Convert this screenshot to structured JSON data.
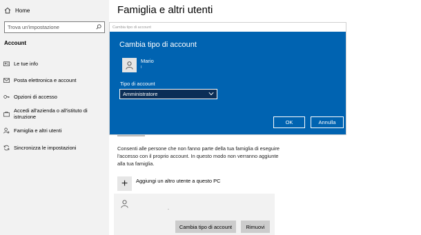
{
  "sidebar": {
    "home_label": "Home",
    "search_placeholder": "Trova un'impostazione",
    "section_title": "Account",
    "items": [
      {
        "label": "Le tue info",
        "icon": "user-card-icon"
      },
      {
        "label": "Posta elettronica e account",
        "icon": "mail-icon"
      },
      {
        "label": "Opzioni di accesso",
        "icon": "key-icon"
      },
      {
        "label": "Accedi all'azienda o all'istituto di istruzione",
        "icon": "briefcase-icon"
      },
      {
        "label": "Famiglia e altri utenti",
        "icon": "person-add-icon"
      },
      {
        "label": "Sincronizza le impostazioni",
        "icon": "sync-icon"
      }
    ]
  },
  "main": {
    "title": "Famiglia e altri utenti",
    "description": "Consenti alle persone che non fanno parte della tua famiglia di eseguire l'accesso con il proprio account. In questo modo non verranno aggiunte alla tua famiglia.",
    "add_user_label": "Aggiungi un altro utente a questo PC",
    "user_card": {
      "dot": ".",
      "change_button": "Cambia tipo di account",
      "remove_button": "Rimuovi"
    }
  },
  "dialog": {
    "titlebar": "Cambia tipo di account",
    "heading": "Cambia tipo di account",
    "user_name": "Mario",
    "user_sub": "I",
    "type_label": "Tipo di account",
    "selected_type": "Amministratore",
    "ok_label": "OK",
    "cancel_label": "Annulla"
  },
  "colors": {
    "accent": "#0063b1",
    "select_bg": "#0b2e57",
    "sidebar_bg": "#f2f2f2"
  }
}
